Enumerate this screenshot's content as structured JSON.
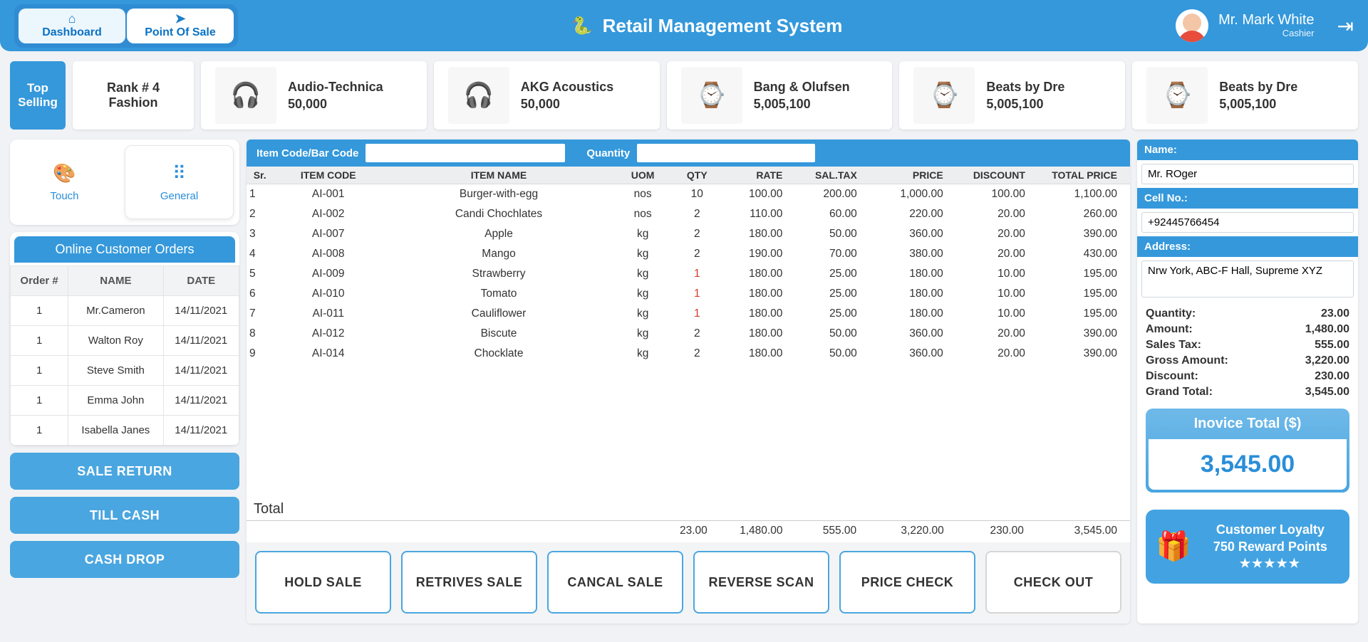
{
  "header": {
    "tabs": [
      {
        "icon": "⌂",
        "label": "Dashboard"
      },
      {
        "icon": "➤",
        "label": "Point Of Sale"
      }
    ],
    "app_title": "Retail Management System",
    "user_name": "Mr. Mark White",
    "user_role": "Cashier"
  },
  "top_selling": {
    "badge_line1": "Top",
    "badge_line2": "Selling",
    "rank_line1": "Rank # 4",
    "rank_line2": "Fashion",
    "products": [
      {
        "name": "Audio-Technica",
        "price": "50,000",
        "emoji": "🎧",
        "tint": "#d42b1f"
      },
      {
        "name": "AKG Acoustics",
        "price": "50,000",
        "emoji": "🎧",
        "tint": "#6c1313"
      },
      {
        "name": "Bang & Olufsen",
        "price": "5,005,100",
        "emoji": "⌚",
        "tint": "#2a2a2a"
      },
      {
        "name": "Beats by Dre",
        "price": "5,005,100",
        "emoji": "⌚",
        "tint": "#555"
      },
      {
        "name": "Beats by Dre",
        "price": "5,005,100",
        "emoji": "⌚",
        "tint": "#888"
      }
    ]
  },
  "modes": {
    "touch": "Touch",
    "general": "General"
  },
  "orders": {
    "title": "Online Customer Orders",
    "cols": [
      "Order #",
      "NAME",
      "DATE"
    ],
    "rows": [
      {
        "n": "1",
        "name": "Mr.Cameron",
        "date": "14/11/2021"
      },
      {
        "n": "1",
        "name": "Walton Roy",
        "date": "14/11/2021"
      },
      {
        "n": "1",
        "name": "Steve Smith",
        "date": "14/11/2021"
      },
      {
        "n": "1",
        "name": "Emma John",
        "date": "14/11/2021"
      },
      {
        "n": "1",
        "name": "Isabella Janes",
        "date": "14/11/2021"
      }
    ]
  },
  "left_buttons": [
    "SALE RETURN",
    "TILL CASH",
    "CASH DROP"
  ],
  "scan": {
    "code_label": "Item Code/Bar Code",
    "qty_label": "Quantity"
  },
  "grid": {
    "cols": [
      "Sr.",
      "ITEM CODE",
      "ITEM NAME",
      "UOM",
      "QTY",
      "RATE",
      "SAL.TAX",
      "PRICE",
      "DISCOUNT",
      "TOTAL PRICE"
    ],
    "rows": [
      {
        "sr": "1",
        "code": "AI-001",
        "name": "Burger-with-egg",
        "uom": "nos",
        "qty": "10",
        "rate": "100.00",
        "tax": "200.00",
        "price": "1,000.00",
        "disc": "100.00",
        "total": "1,100.00"
      },
      {
        "sr": "2",
        "code": "AI-002",
        "name": "Candi Chochlates",
        "uom": "nos",
        "qty": "2",
        "rate": "110.00",
        "tax": "60.00",
        "price": "220.00",
        "disc": "20.00",
        "total": "260.00"
      },
      {
        "sr": "3",
        "code": "AI-007",
        "name": "Apple",
        "uom": "kg",
        "qty": "2",
        "rate": "180.00",
        "tax": "50.00",
        "price": "360.00",
        "disc": "20.00",
        "total": "390.00"
      },
      {
        "sr": "4",
        "code": "AI-008",
        "name": "Mango",
        "uom": "kg",
        "qty": "2",
        "rate": "190.00",
        "tax": "70.00",
        "price": "380.00",
        "disc": "20.00",
        "total": "430.00"
      },
      {
        "sr": "5",
        "code": "AI-009",
        "name": "Strawberry",
        "uom": "kg",
        "qty": "1",
        "rate": "180.00",
        "tax": "25.00",
        "price": "180.00",
        "disc": "10.00",
        "total": "195.00"
      },
      {
        "sr": "6",
        "code": "AI-010",
        "name": "Tomato",
        "uom": "kg",
        "qty": "1",
        "rate": "180.00",
        "tax": "25.00",
        "price": "180.00",
        "disc": "10.00",
        "total": "195.00"
      },
      {
        "sr": "7",
        "code": "AI-011",
        "name": "Cauliflower",
        "uom": "kg",
        "qty": "1",
        "rate": "180.00",
        "tax": "25.00",
        "price": "180.00",
        "disc": "10.00",
        "total": "195.00"
      },
      {
        "sr": "8",
        "code": "AI-012",
        "name": "Biscute",
        "uom": "kg",
        "qty": "2",
        "rate": "180.00",
        "tax": "50.00",
        "price": "360.00",
        "disc": "20.00",
        "total": "390.00"
      },
      {
        "sr": "9",
        "code": "AI-014",
        "name": "Chocklate",
        "uom": "kg",
        "qty": "2",
        "rate": "180.00",
        "tax": "50.00",
        "price": "360.00",
        "disc": "20.00",
        "total": "390.00"
      }
    ],
    "total_label": "Total",
    "totals": {
      "qty": "23.00",
      "rate": "1,480.00",
      "tax": "555.00",
      "price": "3,220.00",
      "disc": "230.00",
      "total": "3,545.00"
    }
  },
  "actions": [
    "HOLD SALE",
    "RETRIVES SALE",
    "CANCAL SALE",
    "REVERSE SCAN",
    "PRICE CHECK",
    "CHECK OUT"
  ],
  "customer": {
    "name_lab": "Name:",
    "name": "Mr. ROger",
    "cell_lab": "Cell No.:",
    "cell": "+92445766454",
    "addr_lab": "Address:",
    "addr": "Nrw York, ABC-F Hall, Supreme XYZ"
  },
  "summary": [
    {
      "k": "Quantity:",
      "v": "23.00"
    },
    {
      "k": "Amount:",
      "v": "1,480.00"
    },
    {
      "k": "Sales Tax:",
      "v": "555.00"
    },
    {
      "k": "Gross Amount:",
      "v": "3,220.00"
    },
    {
      "k": "Discount:",
      "v": "230.00"
    },
    {
      "k": "Grand Total:",
      "v": "3,545.00"
    }
  ],
  "invoice": {
    "label": "Inovice Total ($)",
    "value": "3,545.00"
  },
  "loyalty": {
    "title": "Customer Loyalty",
    "points": "750 Reward Points",
    "stars": "★★★★★"
  }
}
